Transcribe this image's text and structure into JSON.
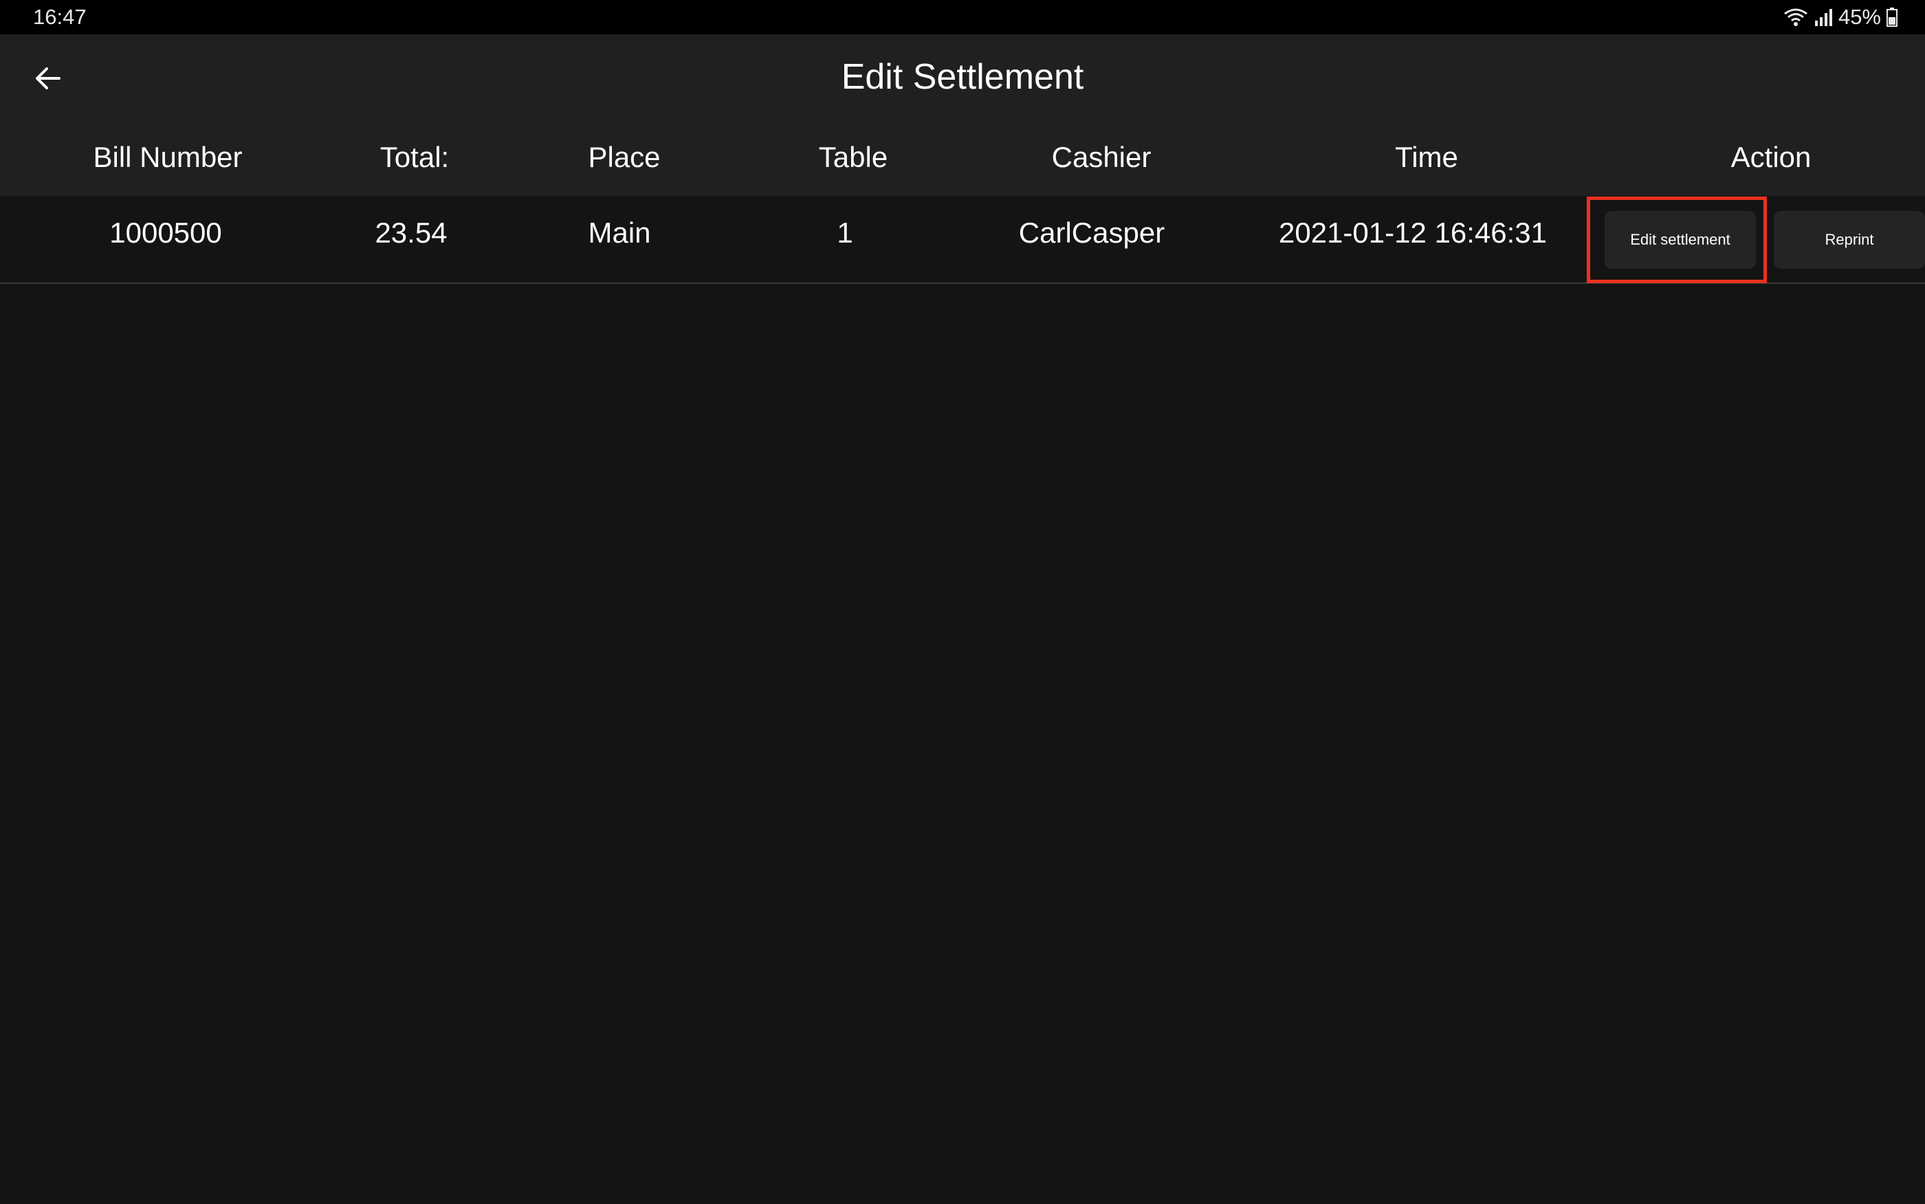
{
  "status_bar": {
    "time": "16:47",
    "battery": "45%"
  },
  "app_bar": {
    "title": "Edit Settlement",
    "back_icon": "arrow-left-icon"
  },
  "table": {
    "headers": {
      "bill_number": "Bill Number",
      "total": "Total:",
      "place": "Place",
      "table": "Table",
      "cashier": "Cashier",
      "time": "Time",
      "action": "Action"
    },
    "rows": [
      {
        "bill_number": "1000500",
        "total": "23.54",
        "place": "Main",
        "table": "1",
        "cashier": "CarlCasper",
        "time": "2021-01-12 16:46:31",
        "edit_label": "Edit settlement",
        "reprint_label": "Reprint"
      }
    ]
  },
  "colors": {
    "background": "#141414",
    "bar": "#202020",
    "highlight": "#e8321e"
  }
}
